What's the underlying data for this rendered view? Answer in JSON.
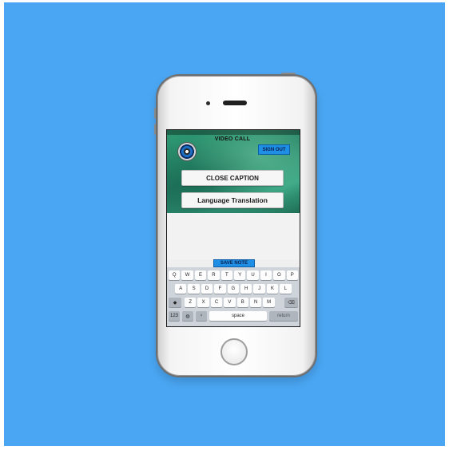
{
  "screen": {
    "title": "VIDEO CALL",
    "sign_out_label": "SIGN OUT",
    "close_caption_label": "CLOSE CAPTION",
    "language_translation_label": "Language Translation",
    "save_note_label": "SAVE NOTE"
  },
  "keyboard": {
    "row1": [
      "Q",
      "W",
      "E",
      "R",
      "T",
      "Y",
      "U",
      "I",
      "O",
      "P"
    ],
    "row2": [
      "A",
      "S",
      "D",
      "F",
      "G",
      "H",
      "J",
      "K",
      "L"
    ],
    "row3": [
      "Z",
      "X",
      "C",
      "V",
      "B",
      "N",
      "M"
    ],
    "shift_glyph": "◆",
    "delete_glyph": "⌫",
    "numbers_label": "123",
    "globe_glyph": "◍",
    "mic_glyph": "♀",
    "space_label": "space",
    "return_label": "return"
  },
  "colors": {
    "background": "#4aa6f3",
    "accent_button": "#1f8fe6",
    "app_header_green": "#2a8a69"
  }
}
